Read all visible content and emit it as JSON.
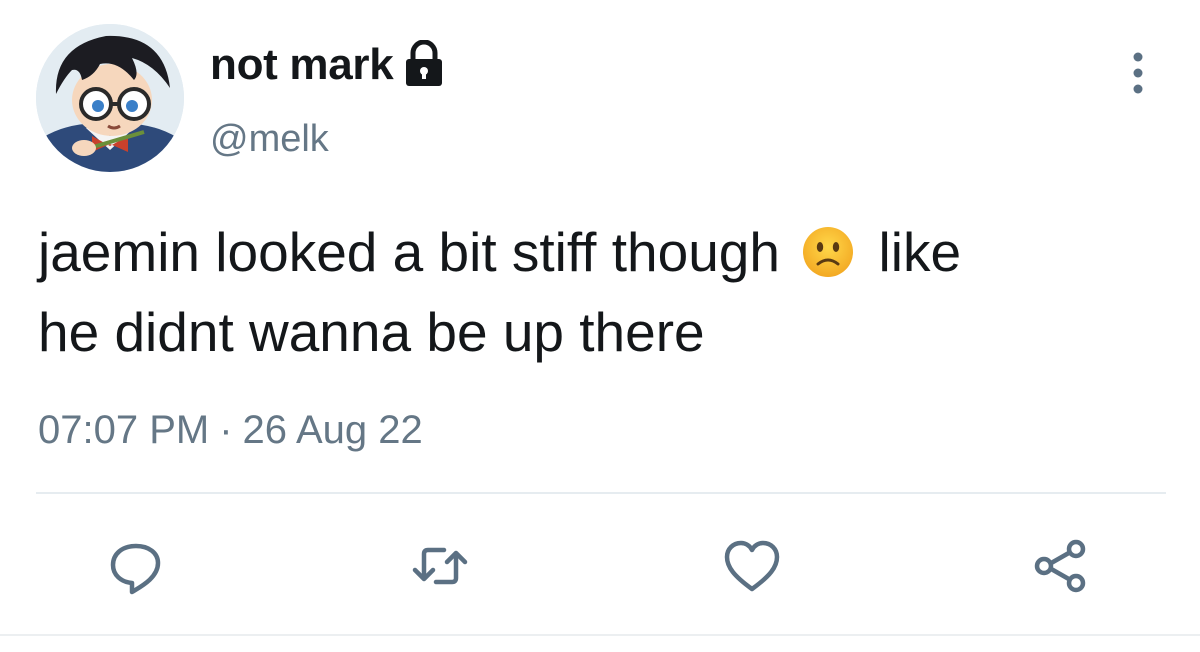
{
  "user": {
    "display_name": "not mark",
    "handle": "@melk",
    "avatar_icon": "anime-character-avatar",
    "protected_icon": "lock-icon"
  },
  "tweet": {
    "line1_before_emoji": "jaemin looked a bit stiff though",
    "emoji": "slightly-frowning-face",
    "line1_after_emoji": "like",
    "line2": "he didnt wanna be up there"
  },
  "meta": {
    "time": "07:07 PM",
    "separator": "·",
    "date": "26 Aug 22"
  },
  "actions": [
    {
      "name": "reply",
      "icon": "reply-icon"
    },
    {
      "name": "retweet",
      "icon": "retweet-icon"
    },
    {
      "name": "like",
      "icon": "heart-icon"
    },
    {
      "name": "share",
      "icon": "share-icon"
    }
  ],
  "colors": {
    "text": "#14171a",
    "secondary": "#657786",
    "icon": "#5b7083",
    "divider": "#e6ecf0"
  }
}
